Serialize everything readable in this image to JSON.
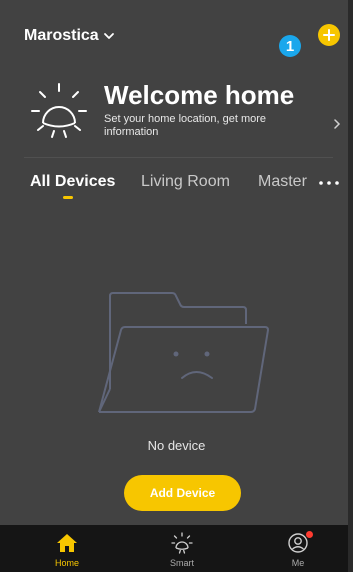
{
  "header": {
    "home_name": "Marostica",
    "notification_count": "1",
    "add_icon": "plus-icon"
  },
  "welcome": {
    "title": "Welcome home",
    "subtitle": "Set your home location, get more information"
  },
  "tabs": [
    {
      "label": "All Devices",
      "active": true
    },
    {
      "label": "Living Room",
      "active": false
    },
    {
      "label": "Master",
      "active": false
    }
  ],
  "empty_state": {
    "message": "No device",
    "button_label": "Add Device"
  },
  "bottom_nav": [
    {
      "label": "Home",
      "icon": "home-icon",
      "active": true
    },
    {
      "label": "Smart",
      "icon": "sun-icon",
      "active": false
    },
    {
      "label": "Me",
      "icon": "user-icon",
      "active": false
    }
  ],
  "colors": {
    "accent": "#f7c600",
    "background": "#424242",
    "nav_background": "#151515",
    "badge": "#1aa7ec",
    "notification_dot": "#ff3b30"
  }
}
